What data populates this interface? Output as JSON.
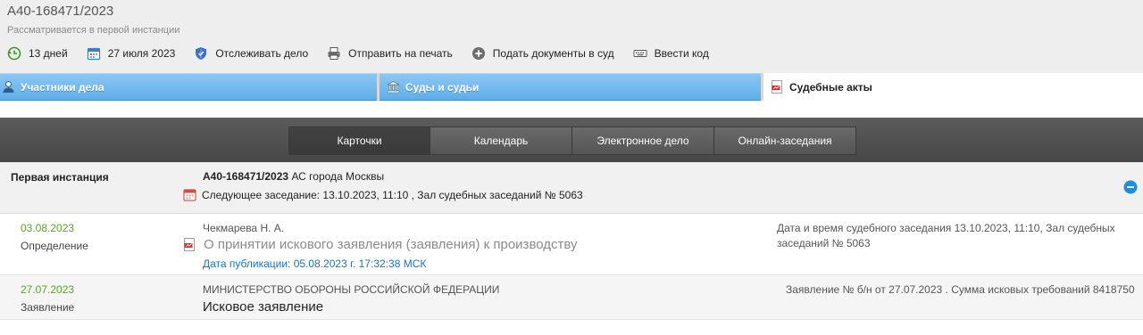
{
  "header": {
    "case_number": "А40-168471/2023",
    "status": "Рассматривается в первой инстанции"
  },
  "toolbar": {
    "days_label": "13 дней",
    "date_label": "27 июля 2023",
    "track_label": "Отслеживать дело",
    "print_label": "Отправить на печать",
    "submit_label": "Подать документы в суд",
    "code_label": "Ввести код",
    "icons": [
      "clock-back-icon",
      "calendar-icon",
      "shield-icon",
      "printer-icon",
      "plus-circle-icon",
      "keyboard-icon"
    ]
  },
  "tabs": {
    "participants": "Участники дела",
    "courts": "Суды и судьи",
    "acts": "Судебные акты",
    "active": "acts"
  },
  "subtabs": {
    "items": [
      "Карточки",
      "Календарь",
      "Электронное дело",
      "Онлайн-заседания"
    ],
    "active": "Карточки"
  },
  "instance": {
    "title": "Первая инстанция",
    "case_number": "А40-168471/2023",
    "court": "АС города Москвы",
    "next_session": "Следующее заседание: 13.10.2023, 11:10 , Зал судебных заседаний № 5063"
  },
  "rows": [
    {
      "date": "03.08.2023",
      "type": "Определение",
      "judge": "Чекмарева Н. А.",
      "document": "О принятии искового заявления (заявления) к производству",
      "published": "Дата публикации: 05.08.2023 г. 17:32:38 МСК",
      "note": "Дата и время судебного заседания 13.10.2023, 11:10, Зал судебных заседаний № 5063"
    },
    {
      "date": "27.07.2023",
      "type": "Заявление",
      "party": "МИНИСТЕРСТВО ОБОРОНЫ РОССИЙСКОЙ ФЕДЕРАЦИИ",
      "document": "Исковое заявление",
      "note": "Заявление № б/н от 27.07.2023 . Сумма исковых требований 8418750"
    }
  ],
  "colors": {
    "tab_blue": "#6bb6ec",
    "dark_bar": "#4f4f4f",
    "date_green": "#5aa02c",
    "link_blue": "#1a73b8",
    "pdf_red": "#d32f2f"
  }
}
